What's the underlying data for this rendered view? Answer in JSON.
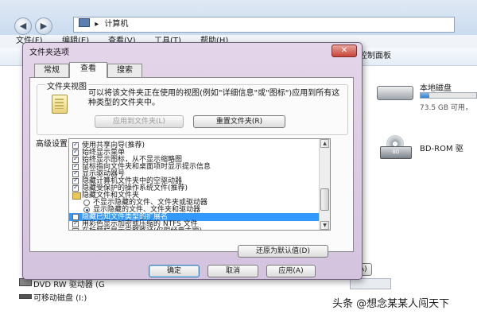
{
  "explorer": {
    "breadcrumb": "计算机",
    "breadcrumb_sep": "▸",
    "menu": [
      "文件(F)",
      "编辑(E)",
      "查看(V)",
      "工具(T)",
      "帮助(H)"
    ],
    "toolbar_right": "控制面板",
    "drives": [
      {
        "name": "本地磁盘",
        "size": "73.5 GB 可用，",
        "used_fraction": 0.15
      },
      {
        "name": "BD-ROM 驱",
        "icon_text": "BD"
      }
    ],
    "left_items": [
      "DVD RW 驱动器 (G",
      "可移动磁盘 (I:)"
    ]
  },
  "dialog": {
    "title": "文件夹选项",
    "close": "✕",
    "tabs": [
      "常规",
      "查看",
      "搜索"
    ],
    "active_tab": 1,
    "folder_view": {
      "label": "文件夹视图",
      "description": "可以将该文件夹正在使用的视图(例如\"详细信息\"或\"图标\")应用到所有这种类型的文件夹中。",
      "apply_button": "应用到文件夹(L)",
      "reset_button": "重置文件夹(R)"
    },
    "advanced": {
      "label": "高级设置:",
      "rows": [
        {
          "text": "使用共享向导(推荐)",
          "type": "checkbox",
          "checked": true,
          "indent": 0
        },
        {
          "text": "始终显示菜单",
          "type": "checkbox",
          "checked": true,
          "indent": 0
        },
        {
          "text": "始终显示图标，从不显示缩略图",
          "type": "checkbox",
          "checked": true,
          "indent": 0
        },
        {
          "text": "鼠标指向文件夹和桌面项时显示提示信息",
          "type": "checkbox",
          "checked": true,
          "indent": 0
        },
        {
          "text": "显示驱动器号",
          "type": "checkbox",
          "checked": true,
          "indent": 0
        },
        {
          "text": "隐藏计算机文件夹中的空驱动器",
          "type": "checkbox",
          "checked": true,
          "indent": 0
        },
        {
          "text": "隐藏受保护的操作系统文件(推荐)",
          "type": "checkbox",
          "checked": true,
          "indent": 0
        },
        {
          "text": "隐藏文件和文件夹",
          "type": "folder",
          "indent": 0
        },
        {
          "text": "不显示隐藏的文件、文件夹或驱动器",
          "type": "radio",
          "checked": false,
          "indent": 1
        },
        {
          "text": "显示隐藏的文件、文件夹和驱动器",
          "type": "radio",
          "checked": true,
          "indent": 1
        },
        {
          "text": "隐藏已知文件类型的扩展名",
          "type": "checkbox",
          "checked": false,
          "indent": 0,
          "selected": true
        },
        {
          "text": "用彩色显示加密或压缩的 NTFS 文件",
          "type": "checkbox",
          "checked": true,
          "indent": 0
        },
        {
          "text": "在标题栏显示完整路径(仅限经典主题)",
          "type": "checkbox",
          "checked": false,
          "indent": 0
        }
      ],
      "restore_button": "还原为默认值(D)"
    },
    "ok_button": "确定",
    "cancel_button": "取消",
    "apply_button": "应用(A)"
  },
  "behind_apply_button": "应用(A)",
  "watermark": "头条 @想念某某人闯天下",
  "colors": {
    "selection": "#3399ff",
    "dialog_frame": "#d3c3de",
    "titlebar": "#cbdcef"
  }
}
